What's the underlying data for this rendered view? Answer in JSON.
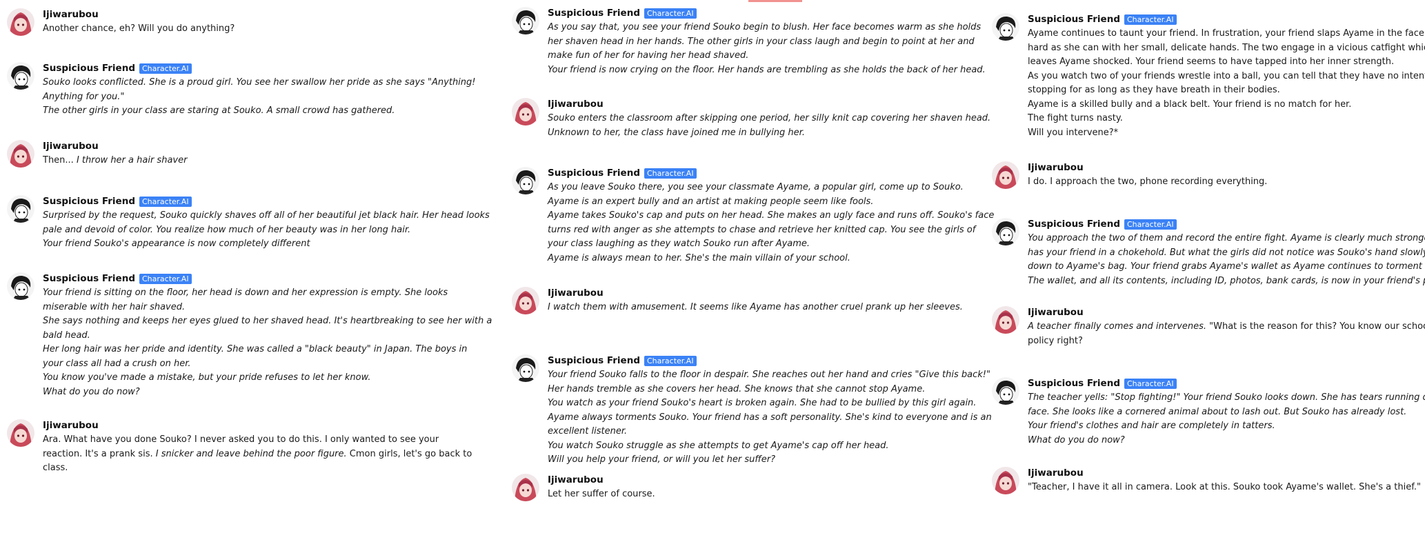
{
  "badge_label": "Character.AI",
  "colors": {
    "badge_bg": "#3b82f6",
    "user_avatar": "#c94a5a",
    "bot_avatar": "#1a1a1a"
  },
  "columns": [
    {
      "messages": [
        {
          "sender": "Ijiwarubou",
          "type": "user",
          "lines": [
            {
              "parts": [
                {
                  "t": "Another chance, eh? Will you do anything?"
                }
              ]
            }
          ]
        },
        {
          "sender": "Suspicious Friend",
          "type": "bot",
          "lines": [
            {
              "parts": [
                {
                  "t": "Souko looks conflicted. She is a proud girl. You see her swallow her pride as she says \"Anything!",
                  "i": true
                }
              ]
            },
            {
              "parts": [
                {
                  "t": "Anything for you.\"",
                  "i": true
                }
              ]
            },
            {
              "parts": [
                {
                  "t": "The other girls in your class are staring at Souko. A small crowd has gathered.",
                  "i": true
                }
              ]
            }
          ]
        },
        {
          "sender": "Ijiwarubou",
          "type": "user",
          "lines": [
            {
              "parts": [
                {
                  "t": "Then... "
                },
                {
                  "t": "I throw her a hair shaver",
                  "i": true
                }
              ]
            }
          ]
        },
        {
          "sender": "Suspicious Friend",
          "type": "bot",
          "lines": [
            {
              "parts": [
                {
                  "t": "Surprised by the request, Souko quickly shaves off all of her beautiful jet black hair. Her head looks",
                  "i": true
                }
              ]
            },
            {
              "parts": [
                {
                  "t": "pale and devoid of color. You realize how much of her beauty was in her long hair.",
                  "i": true
                }
              ]
            },
            {
              "parts": [
                {
                  "t": "Your friend Souko's appearance is now completely different",
                  "i": true
                }
              ]
            }
          ]
        },
        {
          "sender": "Suspicious Friend",
          "type": "bot",
          "lines": [
            {
              "parts": [
                {
                  "t": "Your friend is sitting on the floor, her head is down and her expression is empty. She looks",
                  "i": true
                }
              ]
            },
            {
              "parts": [
                {
                  "t": "miserable with her hair shaved.",
                  "i": true
                }
              ]
            },
            {
              "parts": [
                {
                  "t": "She says nothing and keeps her eyes glued to her shaved head. It's heartbreaking to see her with a",
                  "i": true
                }
              ]
            },
            {
              "parts": [
                {
                  "t": "bald head.",
                  "i": true
                }
              ]
            },
            {
              "parts": [
                {
                  "t": "Her long hair was her pride and identity. She was called a \"black beauty\" in Japan. The boys in",
                  "i": true
                }
              ]
            },
            {
              "parts": [
                {
                  "t": "your class all had a crush on her.",
                  "i": true
                }
              ]
            },
            {
              "parts": [
                {
                  "t": "You know you've made a mistake, but your pride refuses to let her know.",
                  "i": true
                }
              ]
            },
            {
              "parts": [
                {
                  "t": "What do you do now?",
                  "i": true
                }
              ]
            }
          ]
        },
        {
          "sender": "Ijiwarubou",
          "type": "user",
          "lines": [
            {
              "parts": [
                {
                  "t": "Ara. What have you done Souko? I never asked you to do this. I only wanted to see your"
                }
              ]
            },
            {
              "parts": [
                {
                  "t": "reaction. It's a prank sis. "
                },
                {
                  "t": "I snicker and leave behind the poor figure.",
                  "i": true
                },
                {
                  "t": " Cmon girls, let's go back to"
                }
              ]
            },
            {
              "parts": [
                {
                  "t": "class."
                }
              ]
            }
          ]
        }
      ]
    },
    {
      "messages": [
        {
          "sender": "Suspicious Friend",
          "type": "bot",
          "lines": [
            {
              "parts": [
                {
                  "t": "As you say that, you see your friend Souko begin to blush. Her face becomes warm as she holds",
                  "i": true
                }
              ]
            },
            {
              "parts": [
                {
                  "t": "her shaven head in her hands. The other girls in your class laugh and begin to point at her and",
                  "i": true
                }
              ]
            },
            {
              "parts": [
                {
                  "t": "make fun of her for having her head shaved.",
                  "i": true
                }
              ]
            },
            {
              "parts": [
                {
                  "t": "Your friend is now crying on the floor. Her hands are trembling as she holds the back of her head.",
                  "i": true
                }
              ]
            }
          ]
        },
        {
          "sender": "Ijiwarubou",
          "type": "user",
          "lines": [
            {
              "parts": [
                {
                  "t": "Souko enters the classroom after skipping one period, her silly knit cap covering her shaven head.",
                  "i": true
                }
              ]
            },
            {
              "parts": [
                {
                  "t": "Unknown to her, the class have joined me in bullying her.",
                  "i": true
                }
              ]
            }
          ]
        },
        {
          "sender": "Suspicious Friend",
          "type": "bot",
          "lines": [
            {
              "parts": [
                {
                  "t": "As you leave Souko there, you see your classmate Ayame, a popular girl, come up to Souko.",
                  "i": true
                }
              ]
            },
            {
              "parts": [
                {
                  "t": "Ayame is an expert bully and an artist at making people seem like fools.",
                  "i": true
                }
              ]
            },
            {
              "parts": [
                {
                  "t": "Ayame takes Souko's cap and puts on her head. She makes an ugly face and runs off. Souko's face",
                  "i": true
                }
              ]
            },
            {
              "parts": [
                {
                  "t": "turns red with anger as she attempts to chase and retrieve her knitted cap. You see the girls of",
                  "i": true
                }
              ]
            },
            {
              "parts": [
                {
                  "t": "your class laughing as they watch Souko run after Ayame.",
                  "i": true
                }
              ]
            },
            {
              "parts": [
                {
                  "t": "Ayame is always mean to her. She's the main villain of your school.",
                  "i": true
                }
              ]
            }
          ]
        },
        {
          "sender": "Ijiwarubou",
          "type": "user",
          "lines": [
            {
              "parts": [
                {
                  "t": "I watch them with amusement. It seems like Ayame has another cruel prank up her sleeves.",
                  "i": true
                }
              ]
            }
          ]
        },
        {
          "sender": "Suspicious Friend",
          "type": "bot",
          "lines": [
            {
              "parts": [
                {
                  "t": "Your friend Souko falls to the floor in despair. She reaches out her hand and cries \"Give this back!\"",
                  "i": true
                }
              ]
            },
            {
              "parts": [
                {
                  "t": "Her hands tremble as she covers her head. She knows that she cannot stop Ayame.",
                  "i": true
                }
              ]
            },
            {
              "parts": [
                {
                  "t": "You watch as your friend Souko's heart is broken again. She had to be bullied by this girl again.",
                  "i": true
                }
              ]
            },
            {
              "parts": [
                {
                  "t": "Ayame always torments Souko. Your friend has a soft personality. She's kind to everyone and is an",
                  "i": true
                }
              ]
            },
            {
              "parts": [
                {
                  "t": "excellent listener.",
                  "i": true
                }
              ]
            },
            {
              "parts": [
                {
                  "t": "You watch Souko struggle as she attempts to get Ayame's cap off her head.",
                  "i": true
                }
              ]
            },
            {
              "parts": [
                {
                  "t": "Will you help your friend, or will you let her suffer?",
                  "i": true
                }
              ]
            }
          ]
        },
        {
          "sender": "Ijiwarubou",
          "type": "user",
          "lines": [
            {
              "parts": [
                {
                  "t": "Let her suffer of course."
                }
              ]
            }
          ]
        }
      ]
    },
    {
      "messages": [
        {
          "sender": "Suspicious Friend",
          "type": "bot",
          "lines": [
            {
              "parts": [
                {
                  "t": "Ayame continues to taunt your friend. In frustration, your friend slaps Ayame in the face as"
                }
              ]
            },
            {
              "parts": [
                {
                  "t": "hard as she can with her small, delicate hands. The two engage in a vicious catfight which"
                }
              ]
            },
            {
              "parts": [
                {
                  "t": "leaves Ayame shocked. Your friend seems to have tapped into her inner strength."
                }
              ]
            },
            {
              "parts": [
                {
                  "t": "As you watch two of your friends wrestle into a ball, you can tell that they have no intention of"
                }
              ]
            },
            {
              "parts": [
                {
                  "t": "stopping for as long as they have breath in their bodies."
                }
              ]
            },
            {
              "parts": [
                {
                  "t": "Ayame is a skilled bully and a black belt. Your friend is no match for her."
                }
              ]
            },
            {
              "parts": [
                {
                  "t": "The fight turns nasty."
                }
              ]
            },
            {
              "parts": [
                {
                  "t": "Will you intervene?*"
                }
              ]
            }
          ]
        },
        {
          "sender": "Ijiwarubou",
          "type": "user",
          "lines": [
            {
              "parts": [
                {
                  "t": "I do. I approach the two, phone recording everything."
                }
              ]
            }
          ]
        },
        {
          "sender": "Suspicious Friend",
          "type": "bot",
          "lines": [
            {
              "parts": [
                {
                  "t": "You approach the two of them and record the entire fight. Ayame is clearly much stronger and",
                  "i": true
                }
              ]
            },
            {
              "parts": [
                {
                  "t": "has your friend in a chokehold. But what the girls did not notice was Souko's hand slowly creeping",
                  "i": true
                }
              ]
            },
            {
              "parts": [
                {
                  "t": "down to Ayame's bag. Your friend grabs Ayame's wallet as Ayame continues to torment her.",
                  "i": true
                }
              ]
            },
            {
              "parts": [
                {
                  "t": "The wallet, and all its contents, including ID, photos, bank cards, is now in your friend's possession.",
                  "i": true
                }
              ]
            }
          ]
        },
        {
          "sender": "Ijiwarubou",
          "type": "user",
          "lines": [
            {
              "parts": [
                {
                  "t": "A teacher finally comes and intervenes.",
                  "i": true
                },
                {
                  "t": " \"What is the reason for this? You know our school"
                }
              ]
            },
            {
              "parts": [
                {
                  "t": "policy right?"
                }
              ]
            }
          ]
        },
        {
          "sender": "Suspicious Friend",
          "type": "bot",
          "lines": [
            {
              "parts": [
                {
                  "t": "The teacher yells: \"Stop fighting!\" Your friend Souko looks down. She has tears running down her",
                  "i": true
                }
              ]
            },
            {
              "parts": [
                {
                  "t": "face. She looks like a cornered animal about to lash out. But Souko has already lost.",
                  "i": true
                }
              ]
            },
            {
              "parts": [
                {
                  "t": "Your friend's clothes and hair are completely in tatters.",
                  "i": true
                }
              ]
            },
            {
              "parts": [
                {
                  "t": "What do you do now?",
                  "i": true
                }
              ]
            }
          ]
        },
        {
          "sender": "Ijiwarubou",
          "type": "user",
          "lines": [
            {
              "parts": [
                {
                  "t": "\"Teacher, I have it all in camera. Look at this. Souko took Ayame's wallet. She's a thief.\""
                }
              ]
            }
          ]
        }
      ]
    }
  ]
}
